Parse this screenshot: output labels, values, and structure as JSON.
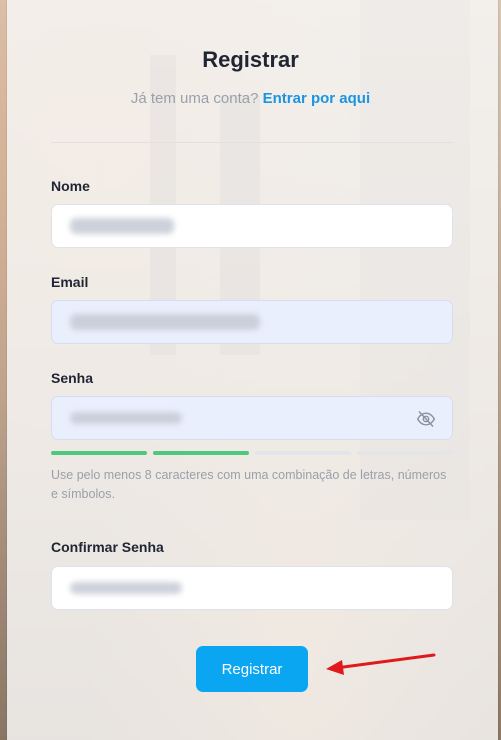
{
  "page": {
    "title": "Registrar",
    "subtitle_prefix": "Já tem uma conta?",
    "login_link": "Entrar por aqui"
  },
  "fields": {
    "name": {
      "label": "Nome"
    },
    "email": {
      "label": "Email"
    },
    "password": {
      "label": "Senha",
      "visibility_icon": "eye-off-icon"
    },
    "confirm": {
      "label": "Confirmar Senha"
    }
  },
  "password_strength": {
    "segments_total": 4,
    "segments_filled": 2,
    "color_on": "#4cc97d",
    "hint": "Use pelo menos 8 caracteres com uma combinação de letras, números e símbolos."
  },
  "submit": {
    "label": "Registrar",
    "color": "#0aa6f2"
  },
  "annotation": {
    "arrow_color": "#e0191d"
  }
}
